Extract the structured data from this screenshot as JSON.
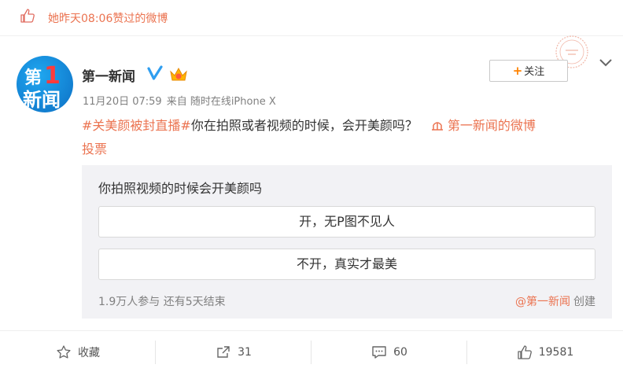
{
  "like_notice": {
    "text": "她昨天08:06赞过的微博"
  },
  "post": {
    "author": "第一新闻",
    "avatar_text_top": "第",
    "avatar_num": "1",
    "avatar_text_bottom": "新闻",
    "follow_label": "关注",
    "time": "11月20日 07:59",
    "source": "来自 随时在线iPhone X",
    "content": {
      "hashtag": "#关美颜被封直播#",
      "text": "你在拍照或者视频的时候，会开美颜吗？",
      "link": "第一新闻的微博",
      "link2": "投票"
    },
    "poll": {
      "question": "你拍照视频的时候会开美颜吗",
      "options": [
        "开，无P图不见人",
        "不开，真实才最美"
      ],
      "stats": "1.9万人参与 还有5天结束",
      "creator_name": "@第一新闻",
      "creator_suffix": "创建"
    },
    "actions": {
      "favorite": "收藏",
      "repost": "31",
      "comment": "60",
      "like": "19581"
    }
  },
  "colors": {
    "accent": "#eb7350",
    "follow_plus": "#ff8200",
    "poll_bg": "#f2f2f5",
    "verified": "#2f9ef0"
  }
}
